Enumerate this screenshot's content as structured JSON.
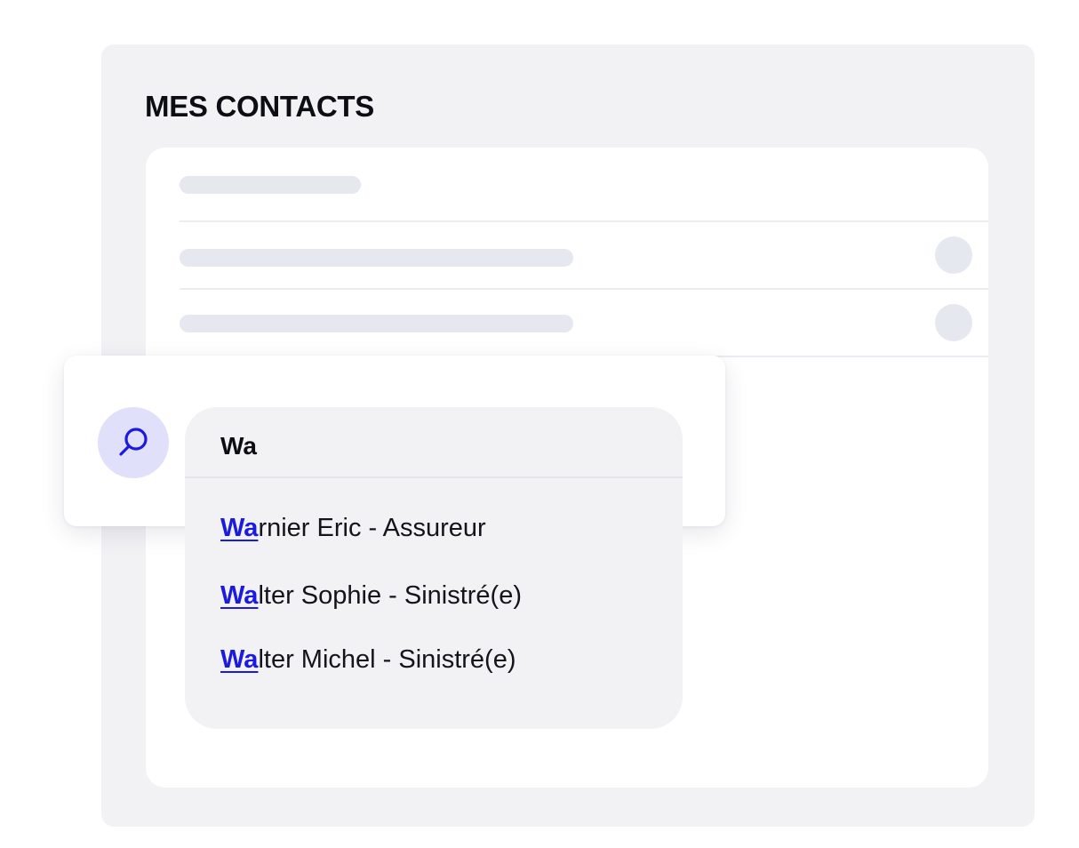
{
  "contacts": {
    "title": "MES CONTACTS"
  },
  "search": {
    "query": "Wa",
    "icon": "search-icon",
    "accent_color": "#1a1ae0",
    "icon_background": "#e0e0fb"
  },
  "suggestions": [
    {
      "match": "Wa",
      "rest": "rnier Eric - Assureur"
    },
    {
      "match": "Wa",
      "rest": "lter Sophie - Sinistré(e)"
    },
    {
      "match": "Wa",
      "rest": "lter Michel - Sinistré(e)"
    }
  ]
}
